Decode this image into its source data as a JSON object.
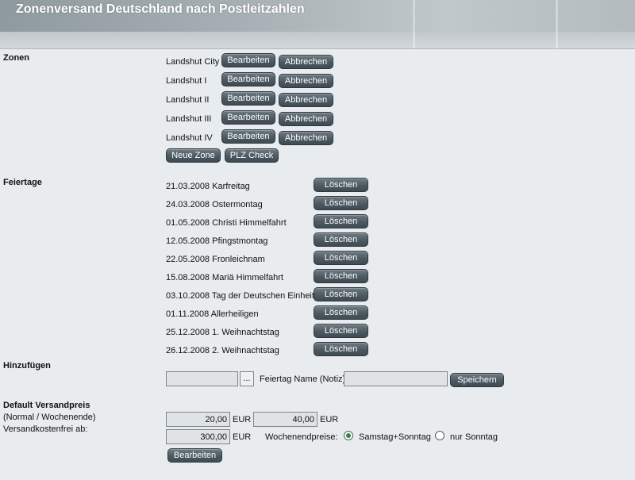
{
  "header": {
    "title": "Zonenversand Deutschland nach Postleitzahlen"
  },
  "zonen": {
    "label": "Zonen",
    "items": [
      {
        "name": "Landshut City",
        "edit": "Bearbeiten",
        "cancel": "Abbrechen"
      },
      {
        "name": "Landshut I",
        "edit": "Bearbeiten",
        "cancel": "Abbrechen"
      },
      {
        "name": "Landshut II",
        "edit": "Bearbeiten",
        "cancel": "Abbrechen"
      },
      {
        "name": "Landshut III",
        "edit": "Bearbeiten",
        "cancel": "Abbrechen"
      },
      {
        "name": "Landshut IV",
        "edit": "Bearbeiten",
        "cancel": "Abbrechen"
      }
    ],
    "new_zone": "Neue Zone",
    "plz_check": "PLZ Check"
  },
  "feiertage": {
    "label": "Feiertage",
    "delete_label": "Löschen",
    "items": [
      "21.03.2008 Karfreitag",
      "24.03.2008 Ostermontag",
      "01.05.2008 Christi Himmelfahrt",
      "12.05.2008 Pfingstmontag",
      "22.05.2008 Fronleichnam",
      "15.08.2008 Mariä Himmelfahrt",
      "03.10.2008 Tag der Deutschen Einheit",
      "01.11.2008 Allerheiligen",
      "25.12.2008 1. Weihnachtstag",
      "26.12.2008 2. Weihnachtstag"
    ]
  },
  "hinzufuegen": {
    "label": "Hinzufügen",
    "date_value": "",
    "picker": "...",
    "name_label": "Feiertag Name (Notiz):",
    "name_value": "",
    "save": "Speichern"
  },
  "versandpreis": {
    "label": "Default Versandpreis",
    "sub_label": "(Normal / Wochenende)",
    "free_label": "Versandkostenfrei ab:",
    "normal_value": "20,00",
    "weekend_value": "40,00",
    "free_value": "300,00",
    "currency": "EUR",
    "weekend_prices_label": "Wochenendpreise:",
    "option_sat_sun": "Samstag+Sonntag",
    "option_sun": "nur Sonntag",
    "selected_option": "Samstag+Sonntag",
    "edit": "Bearbeiten"
  }
}
